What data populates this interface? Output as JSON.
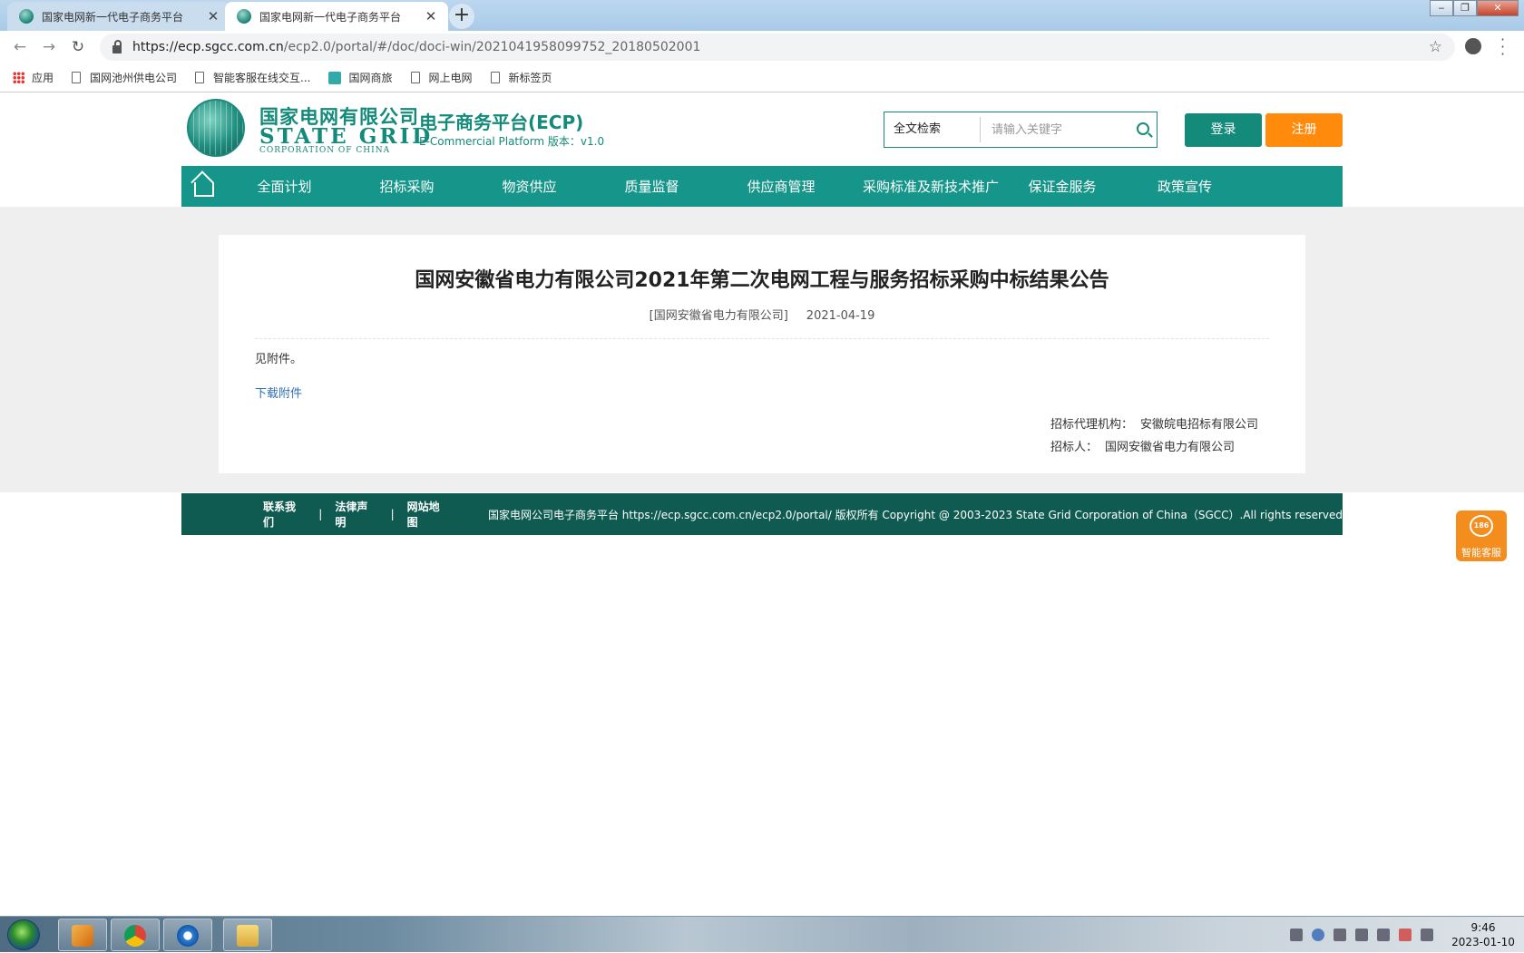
{
  "browser": {
    "tabs": [
      {
        "title": "国家电网新一代电子商务平台",
        "active": false
      },
      {
        "title": "国家电网新一代电子商务平台",
        "active": true
      }
    ],
    "url_host": "https://ecp.sgcc.com.cn",
    "url_path": "/ecp2.0/portal/#/doc/doci-win/2021041958099752_20180502001",
    "bookmarks": [
      {
        "label": "应用",
        "icon": "apps-icon"
      },
      {
        "label": "国网池州供电公司",
        "icon": "page-icon"
      },
      {
        "label": "智能客服在线交互...",
        "icon": "page-icon"
      },
      {
        "label": "国网商旅",
        "icon": "site-icon"
      },
      {
        "label": "网上电网",
        "icon": "page-icon"
      },
      {
        "label": "新标签页",
        "icon": "page-icon"
      }
    ]
  },
  "header": {
    "logo_cn": "国家电网有限公司",
    "logo_en": "STATE GRID",
    "logo_en_sub": "CORPORATION OF CHINA",
    "platform_name": "电子商务平台(ECP)",
    "platform_sub": "E-Commercial Platform 版本：v1.0",
    "search_type": "全文检索",
    "search_placeholder": "请输入关键字",
    "login_label": "登录",
    "register_label": "注册"
  },
  "nav": {
    "items": [
      "全面计划",
      "招标采购",
      "物资供应",
      "质量监督",
      "供应商管理",
      "采购标准及新技术推广",
      "保证金服务",
      "政策宣传"
    ]
  },
  "article": {
    "title": "国网安徽省电力有限公司2021年第二次电网工程与服务招标采购中标结果公告",
    "source": "[国网安徽省电力有限公司]",
    "date": "2021-04-19",
    "body": "见附件。",
    "download_label": "下载附件",
    "agency_label": "招标代理机构：",
    "agency_value": "安徽皖电招标有限公司",
    "tenderer_label": "招标人：",
    "tenderer_value": "国网安徽省电力有限公司"
  },
  "footer": {
    "links": [
      "联系我们",
      "法律声明",
      "网站地图"
    ],
    "separator": "|",
    "copyright": "国家电网公司电子商务平台 https://ecp.sgcc.com.cn/ecp2.0/portal/ 版权所有 Copyright @ 2003-2023 State Grid Corporation of China（SGCC）.All rights reserved"
  },
  "service": {
    "badge": "186",
    "label": "智能客服"
  },
  "taskbar": {
    "time": "9:46",
    "date": "2023-01-10"
  },
  "colors": {
    "brand_green": "#138a7a",
    "nav_green": "#16968a",
    "footer_green": "#0f5b52",
    "register_orange": "#ff8a0c",
    "link_blue": "#2f6fb7"
  }
}
